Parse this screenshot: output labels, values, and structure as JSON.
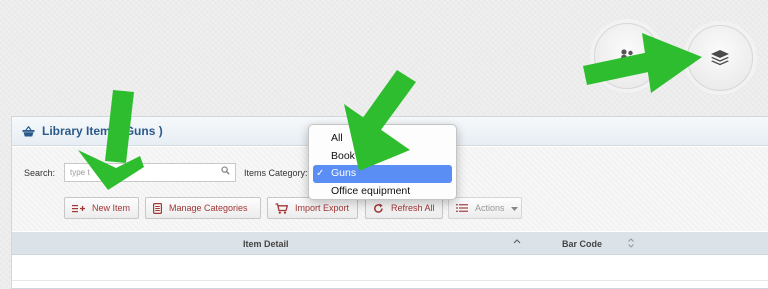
{
  "header_buttons": [
    {
      "icon": "people-icon"
    },
    {
      "icon": "layers-icon"
    }
  ],
  "panel": {
    "icon": "basket-icon",
    "title": "Library Items (Guns )"
  },
  "filters": {
    "search_label": "Search:",
    "search_placeholder": "type t",
    "category_label": "Items Category:"
  },
  "toolbar": {
    "new_item": "New Item",
    "manage_categories": "Manage Categories",
    "import_export": "Import Export",
    "refresh_all": "Refresh All",
    "actions": "Actions"
  },
  "table": {
    "columns": [
      "Item Detail",
      "Bar Code"
    ]
  },
  "category_dropdown": {
    "options": [
      "All",
      "Book",
      "Guns",
      "Office equipment"
    ],
    "selected": "Guns",
    "check_mark": "✓"
  },
  "colors": {
    "accent_blue": "#2b5a8a",
    "button_text": "#a33636",
    "highlight": "#5a8ef5",
    "annotation_arrow": "#2ebd2e"
  }
}
